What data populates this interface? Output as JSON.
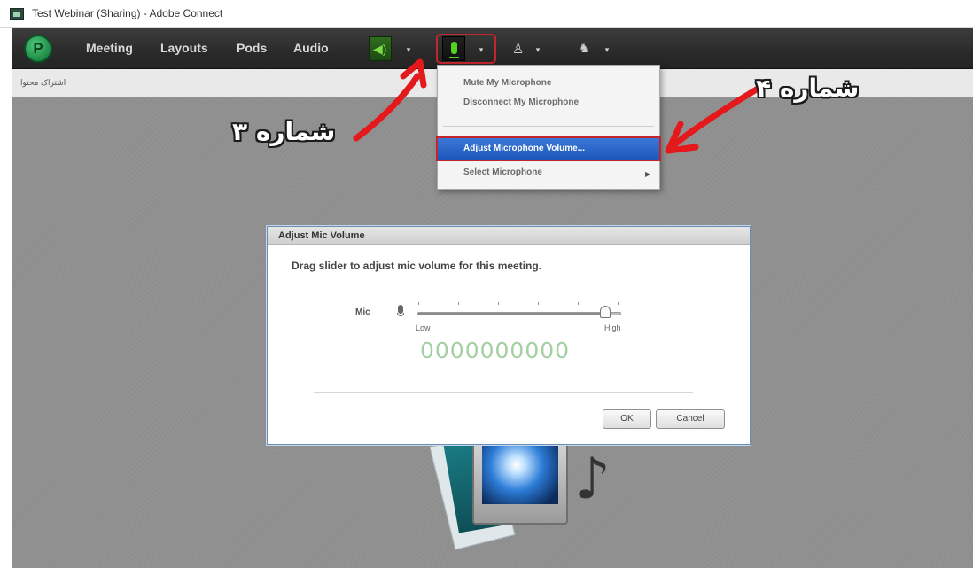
{
  "window": {
    "title": "Test Webinar (Sharing) - Adobe Connect"
  },
  "menubar": {
    "items": [
      {
        "label": "Meeting"
      },
      {
        "label": "Layouts"
      },
      {
        "label": "Pods"
      },
      {
        "label": "Audio"
      }
    ],
    "icons": {
      "logo": "adobe-connect-logo",
      "speaker": "speaker-icon",
      "microphone": "microphone-icon",
      "camera": "webcam-icon",
      "share": "share-status-icon"
    }
  },
  "pod": {
    "title": "اشتراک محتوا"
  },
  "dropdown": {
    "items": [
      {
        "label": "Mute My Microphone"
      },
      {
        "label": "Disconnect My Microphone"
      },
      {
        "label": "Adjust Microphone Volume..."
      },
      {
        "label": "Select Microphone"
      }
    ]
  },
  "dialog": {
    "title": "Adjust Mic Volume",
    "instruction": "Drag slider to adjust mic volume for this meeting.",
    "mic_label": "Mic",
    "low_label": "Low",
    "high_label": "High",
    "meter_display": "0000000000",
    "volume_fraction": 0.92,
    "ok_label": "OK",
    "cancel_label": "Cancel"
  },
  "annotations": {
    "label_3": "شماره ۳",
    "label_4": "شماره ۴",
    "color": "#e3191c"
  }
}
